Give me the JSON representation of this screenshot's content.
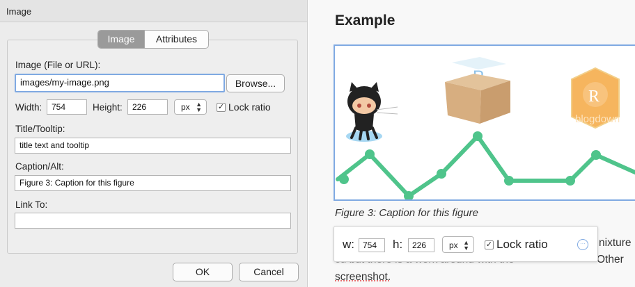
{
  "dialog": {
    "title": "Image",
    "tabs": [
      {
        "label": "Image",
        "active": true
      },
      {
        "label": "Attributes",
        "active": false
      }
    ],
    "image_label": "Image (File or URL):",
    "image_value": "images/my-image.png",
    "browse_label": "Browse...",
    "width_label": "Width:",
    "width_value": "754",
    "height_label": "Height:",
    "height_value": "226",
    "units_value": "px",
    "lock_label": "Lock ratio",
    "lock_checked": true,
    "title_label": "Title/Tooltip:",
    "title_value": "title text and tooltip",
    "caption_label": "Caption/Alt:",
    "caption_value": "Figure 3: Caption for this figure",
    "link_label": "Link To:",
    "link_value": "",
    "ok_label": "OK",
    "cancel_label": "Cancel"
  },
  "preview": {
    "heading": "Example",
    "figure_caption": "Figure 3: Caption for this figure",
    "hex_logo_text": "blogdown",
    "hex_logo_letter": "R",
    "box_logo_letter": "P",
    "body_fragment_1": "nixture",
    "body_fragment_2": "Other",
    "body_line_faded": "cu but there is a work around with the",
    "body_line_3": "screenshot.",
    "toolbar": {
      "w_label": "w:",
      "w_value": "754",
      "h_label": "h:",
      "h_value": "226",
      "units_value": "px",
      "lock_label": "Lock ratio"
    }
  },
  "colors": {
    "accent_blue": "#7fa9e2",
    "line_green": "#4fc48b",
    "hex_orange": "#f6b55e"
  }
}
